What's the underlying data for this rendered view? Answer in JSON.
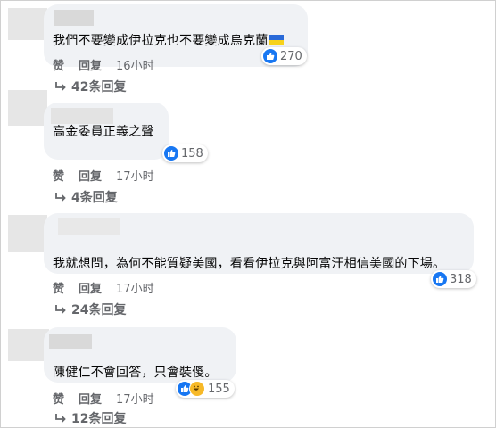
{
  "comments": [
    {
      "text": "我們不要變成伊拉克也不要變成烏克蘭",
      "flag": "ukraine-flag",
      "reactions": "270",
      "like_label": "赞",
      "reply_label": "回复",
      "time": "16小时",
      "replies_label": "42条回复"
    },
    {
      "text": "高金委員正義之聲",
      "reactions": "158",
      "like_label": "赞",
      "reply_label": "回复",
      "time": "17小时",
      "replies_label": "4条回复"
    },
    {
      "text": "我就想問，為何不能質疑美國，看看伊拉克與阿富汗相信美國的下場。",
      "reactions": "318",
      "like_label": "赞",
      "reply_label": "回复",
      "time": "17小时",
      "replies_label": "24条回复"
    },
    {
      "text": "陳健仁不會回答，只會裝傻。",
      "reactions": "155",
      "like_label": "赞",
      "reply_label": "回复",
      "time": "17小时",
      "replies_label": "12条回复"
    }
  ],
  "colors": {
    "bubble": "#f0f2f5",
    "like": "#1877f2",
    "haha": "#f7b928",
    "meta_text": "#65676b",
    "body_text": "#050505"
  }
}
